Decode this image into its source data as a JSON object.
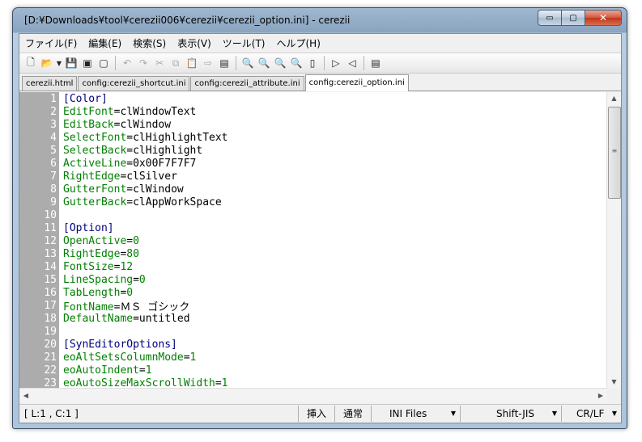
{
  "window": {
    "title": "[D:¥Downloads¥tool¥cerezii006¥cerezii¥cerezii_option.ini] - cerezii",
    "min_label": "▭",
    "max_label": "▢",
    "close_label": "✕"
  },
  "menu": [
    "ファイル(F)",
    "編集(E)",
    "検索(S)",
    "表示(V)",
    "ツール(T)",
    "ヘルプ(H)"
  ],
  "toolbar_icons": [
    "new-file-icon",
    "open-icon",
    "dropdown-icon",
    "save-icon",
    "save-as-icon",
    "close-file-icon",
    "undo-icon",
    "redo-icon",
    "cut-icon",
    "copy-icon",
    "paste-icon",
    "paste-special-icon",
    "select-all-icon",
    "find-icon",
    "find-next-icon",
    "find-prev-icon",
    "replace-icon",
    "highlight-icon",
    "next-tab-icon",
    "prev-tab-icon",
    "settings-icon"
  ],
  "tabs": [
    {
      "label": "cerezii.html",
      "active": false
    },
    {
      "label": "config:cerezii_shortcut.ini",
      "active": false
    },
    {
      "label": "config:cerezii_attribute.ini",
      "active": false
    },
    {
      "label": "config:cerezii_option.ini",
      "active": true
    }
  ],
  "lines": [
    {
      "n": "1",
      "key": "[Color]",
      "val": "",
      "section": true
    },
    {
      "n": "2",
      "key": "EditFont",
      "val": "clWindowText"
    },
    {
      "n": "3",
      "key": "EditBack",
      "val": "clWindow"
    },
    {
      "n": "4",
      "key": "SelectFont",
      "val": "clHighlightText"
    },
    {
      "n": "5",
      "key": "SelectBack",
      "val": "clHighlight"
    },
    {
      "n": "6",
      "key": "ActiveLine",
      "val": "0x00F7F7F7"
    },
    {
      "n": "7",
      "key": "RightEdge",
      "val": "clSilver"
    },
    {
      "n": "8",
      "key": "GutterFont",
      "val": "clWindow"
    },
    {
      "n": "9",
      "key": "GutterBack",
      "val": "clAppWorkSpace"
    },
    {
      "n": "10",
      "key": "",
      "val": ""
    },
    {
      "n": "11",
      "key": "[Option]",
      "val": "",
      "section": true
    },
    {
      "n": "12",
      "key": "OpenActive",
      "val": "0",
      "green": true
    },
    {
      "n": "13",
      "key": "RightEdge",
      "val": "80",
      "green": true
    },
    {
      "n": "14",
      "key": "FontSize",
      "val": "12",
      "green": true
    },
    {
      "n": "15",
      "key": "LineSpacing",
      "val": "0",
      "green": true
    },
    {
      "n": "16",
      "key": "TabLength",
      "val": "0",
      "green": true
    },
    {
      "n": "17",
      "key": "FontName",
      "val": "ＭＳ ゴシック"
    },
    {
      "n": "18",
      "key": "DefaultName",
      "val": "untitled"
    },
    {
      "n": "19",
      "key": "",
      "val": ""
    },
    {
      "n": "20",
      "key": "[SynEditorOptions]",
      "val": "",
      "section": true
    },
    {
      "n": "21",
      "key": "eoAltSetsColumnMode",
      "val": "1",
      "green": true
    },
    {
      "n": "22",
      "key": "eoAutoIndent",
      "val": "1",
      "green": true
    },
    {
      "n": "23",
      "key": "eoAutoSizeMaxScrollWidth",
      "val": "1",
      "green": true
    }
  ],
  "status": {
    "position": "[ L:1 , C:1 ]",
    "insert": "挿入",
    "mode": "通常",
    "filetype": "INI Files",
    "encoding": "Shift-JIS",
    "linebreak": "CR/LF"
  }
}
